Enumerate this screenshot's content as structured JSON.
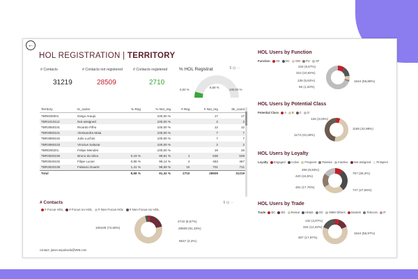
{
  "header": {
    "title_prefix": "HOL REGISTRATION | ",
    "title_bold": "TERRITORY",
    "back_icon": "back-arrow-icon"
  },
  "kpis": [
    {
      "label": "# Contacts",
      "value": "31219",
      "color": "#222222"
    },
    {
      "label": "# Contacts not registered",
      "value": "28509",
      "color": "#c0202a"
    },
    {
      "label": "# Contacts registered",
      "value": "2710",
      "color": "#3aa53a"
    }
  ],
  "gauge": {
    "title": "% HOL Registrat",
    "min_label": "0,00 %",
    "value_label": "8,68 %",
    "max_label": "100,00 %",
    "icons": "⊼ ⊡ ⋯",
    "fraction": 0.0868
  },
  "table": {
    "columns": [
      "Territory",
      "te_name",
      "% Reg",
      "% Not_reg",
      "# Reg",
      "# Not_reg",
      "Ile_count"
    ],
    "rows": [
      [
        "TBRD00001",
        "Diego Araujo",
        "",
        "100,00 %",
        "",
        "17",
        "17"
      ],
      [
        "TBR1010112",
        "Not assigned",
        "",
        "100,00 %",
        "",
        "2",
        "2"
      ],
      [
        "TBR3050101",
        "Ricardo Filho",
        "",
        "100,00 %",
        "",
        "12",
        "12"
      ],
      [
        "TBR3060101",
        "Alessandra Maia",
        "",
        "100,00 %",
        "",
        "7",
        "7"
      ],
      [
        "TBR3060102",
        "Julio Luchini",
        "",
        "100,00 %",
        "",
        "7",
        "7"
      ],
      [
        "TBR3060103",
        "Vinicius Salazar",
        "",
        "100,00 %",
        "",
        "2",
        "2"
      ],
      [
        "TBRD00201",
        "Felipe Mendes",
        "",
        "100,00 %",
        "",
        "19",
        "19"
      ],
      [
        "TBR3020106",
        "Bruno da Silva",
        "0,19 %",
        "99,81 %",
        "1",
        "538",
        "539"
      ],
      [
        "TBR3040102",
        "Filipe Lucas",
        "0,86 %",
        "99,14 %",
        "4",
        "463",
        "467"
      ],
      [
        "TBR3020108",
        "Fabiano Duarte",
        "1,41 %",
        "98,59 %",
        "10",
        "701",
        "711"
      ]
    ],
    "total": [
      "Total",
      "",
      "8,68 %",
      "91,32 %",
      "2710",
      "28509",
      "31219"
    ]
  },
  "contacts_chart": {
    "title": "# Contacts",
    "icons": "⊼ ⊡ ⋯",
    "legend": [
      {
        "name": "# Focus HOL",
        "color": "#c0202a"
      },
      {
        "name": "# Focus no HOL",
        "color": "#6b2e3a"
      },
      {
        "name": "# Non Focus HOL",
        "color": "#d9c9b0"
      },
      {
        "name": "# Non Focus no HOL",
        "color": "#555555"
      }
    ],
    "labels": [
      "2710 (8,67%)",
      "28509 (91,33%)",
      "106429 (72,68%)",
      "5547 (4,4%)"
    ],
    "footer": "contact: jason.sepulveda@WIB.com"
  },
  "chart_data": [
    {
      "type": "pie",
      "title": "# Contacts",
      "categories": [
        "# Focus HOL",
        "# Focus no HOL",
        "# Non Focus HOL",
        "# Non Focus no HOL"
      ],
      "values": [
        2710,
        28509,
        106429,
        5547
      ],
      "colors": [
        "#c0202a",
        "#6b2e3a",
        "#d9c9b0",
        "#555555"
      ]
    },
    {
      "type": "pie",
      "title": "HOL Users by Function",
      "legend_title": "Function",
      "categories": [
        "HS",
        "DC",
        "OM",
        "PU",
        "SF"
      ],
      "values": [
        234,
        310,
        136,
        56,
        1644
      ],
      "labels": [
        "234 (5,67%)",
        "310 (10,92%)",
        "136 (5,62%)",
        "56 (1,33%)",
        "1644 (66,88%)"
      ],
      "colors": [
        "#c0202a",
        "#555555",
        "#d9c9b0",
        "#8c7b6b",
        "#bdbdbd"
      ]
    },
    {
      "type": "pie",
      "title": "HOL Users by Potential Class",
      "legend_title": "Potential Class",
      "categories": [
        "A",
        "B",
        "C",
        "D"
      ],
      "values": [
        126,
        1165,
        1173,
        0
      ],
      "labels": [
        "126 (3,03%)",
        "1165 (42,98%)",
        "1173 (43,28%)"
      ],
      "colors": [
        "#c0202a",
        "#d9c9b0",
        "#6b5a4e",
        "#bdbdbd"
      ]
    },
    {
      "type": "pie",
      "title": "HOL Users by Loyalty",
      "legend_title": "Loyalty",
      "categories": [
        "Engaged",
        "Active",
        "Frequent",
        "Passive",
        "Inactive",
        "Not assigned",
        "Prospect"
      ],
      "values": [
        269,
        767,
        747,
        481,
        420,
        0,
        0
      ],
      "labels": [
        "269 (9,93%)",
        "767 (28,3%)",
        "747 (27,56%)",
        "481 (17,75%)",
        "420 (15,5%)"
      ],
      "colors": [
        "#c0202a",
        "#4a4a4a",
        "#d9c9b0",
        "#8c7b6b",
        "#bdbdbd",
        "#6b2e3a",
        "#ececec"
      ]
    },
    {
      "type": "pie",
      "title": "HOL Users by Trade",
      "legend_title": "Trade",
      "categories": [
        "BC",
        "BO",
        "Rental",
        "HS&D",
        "OC",
        "SMM",
        "Others",
        "Dealers",
        "Telecom",
        "IF"
      ],
      "values": [
        132,
        334,
        1544,
        487,
        0,
        0,
        0,
        0,
        0,
        0
      ],
      "labels": [
        "132 (4,87%)",
        "334 (12,32%)",
        "1544 (56,97%)",
        "487 (17,97%)"
      ],
      "colors": [
        "#c0202a",
        "#6b2e3a",
        "#d9c9b0",
        "#555555",
        "#8c7b6b",
        "#bdbdbd",
        "#e5e5e5",
        "#a33",
        "#777",
        "#c8a"
      ]
    }
  ]
}
